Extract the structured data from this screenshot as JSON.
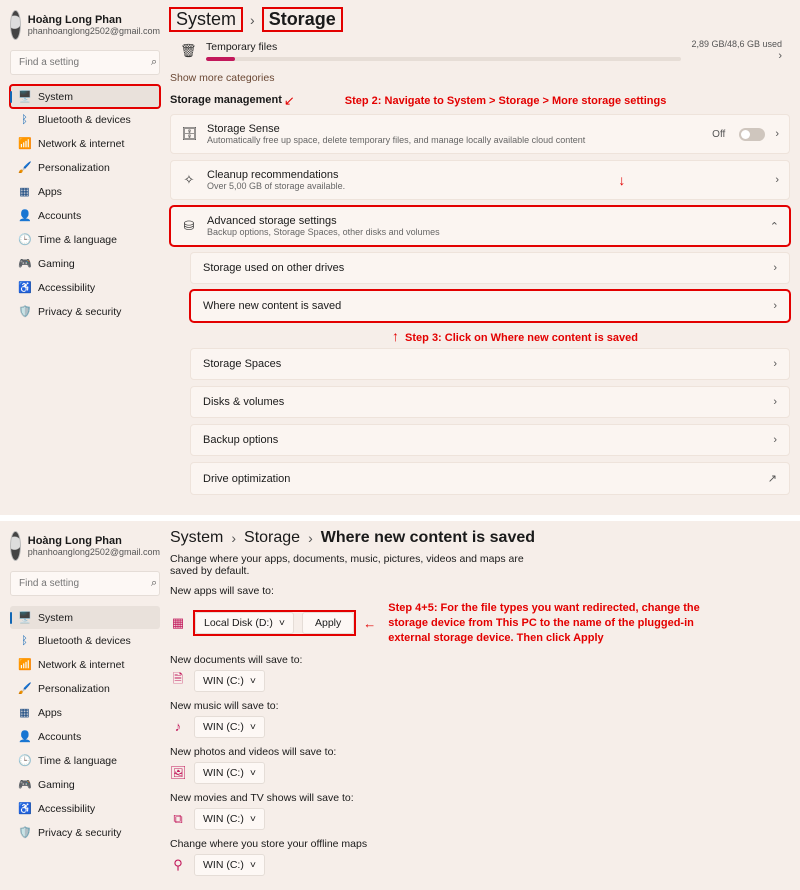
{
  "user": {
    "name": "Hoàng Long Phan",
    "email": "phanhoanglong2502@gmail.com"
  },
  "search_placeholder": "Find a setting",
  "nav": [
    {
      "icon": "🖥️",
      "label": "System",
      "cls": "c-blue",
      "active": true
    },
    {
      "icon": "ᛒ",
      "label": "Bluetooth & devices",
      "cls": "c-blue"
    },
    {
      "icon": "📶",
      "label": "Network & internet",
      "cls": "c-blue"
    },
    {
      "icon": "🖌️",
      "label": "Personalization",
      "cls": "c-orange"
    },
    {
      "icon": "▦",
      "label": "Apps",
      "cls": "c-navy"
    },
    {
      "icon": "👤",
      "label": "Accounts",
      "cls": "c-teal"
    },
    {
      "icon": "🕒",
      "label": "Time & language",
      "cls": "c-green"
    },
    {
      "icon": "🎮",
      "label": "Gaming",
      "cls": "c-purple"
    },
    {
      "icon": "♿",
      "label": "Accessibility",
      "cls": "c-blue"
    },
    {
      "icon": "🛡️",
      "label": "Privacy & security",
      "cls": "c-navy"
    }
  ],
  "top": {
    "crumb": [
      "System",
      "Storage"
    ],
    "temp": {
      "title": "Temporary files",
      "used": "2,89 GB/48,6 GB used"
    },
    "more_cats": "Show more categories",
    "mgmt_title": "Storage management",
    "sense": {
      "title": "Storage Sense",
      "desc": "Automatically free up space, delete temporary files, and manage locally available cloud content",
      "state": "Off"
    },
    "cleanup": {
      "title": "Cleanup recommendations",
      "desc": "Over 5,00 GB of storage available."
    },
    "adv": {
      "title": "Advanced storage settings",
      "desc": "Backup options, Storage Spaces, other disks and volumes"
    },
    "adv_items": [
      "Storage used on other drives",
      "Where new content is saved",
      "Storage Spaces",
      "Disks & volumes",
      "Backup options",
      "Drive optimization"
    ],
    "anno_step2": "Step 2: Navigate to System > Storage > More storage settings",
    "anno_step3": "Step 3: Click on Where new content is saved"
  },
  "bottom": {
    "crumb": [
      "System",
      "Storage",
      "Where new content is saved"
    ],
    "intro": "Change where your apps, documents, music, pictures, videos and maps are saved by default.",
    "apply": "Apply",
    "items": [
      {
        "label": "New apps will save to:",
        "icon": "▦",
        "cls": "c-pink",
        "value": "Local Disk (D:)",
        "boxed": true
      },
      {
        "label": "New documents will save to:",
        "icon": "🗎",
        "cls": "c-pink",
        "value": "WIN (C:)"
      },
      {
        "label": "New music will save to:",
        "icon": "♪",
        "cls": "c-pink",
        "value": "WIN (C:)"
      },
      {
        "label": "New photos and videos will save to:",
        "icon": "🖼",
        "cls": "c-pink",
        "value": "WIN (C:)"
      },
      {
        "label": "New movies and TV shows will save to:",
        "icon": "⧉",
        "cls": "c-pink",
        "value": "WIN (C:)"
      },
      {
        "label": "Change where you store your offline maps",
        "icon": "⚲",
        "cls": "c-pink",
        "value": "WIN (C:)"
      }
    ],
    "anno_step45": "Step 4+5: For the file types you want redirected, change the storage device from This PC to the name of the plugged-in external storage device. Then click Apply"
  }
}
